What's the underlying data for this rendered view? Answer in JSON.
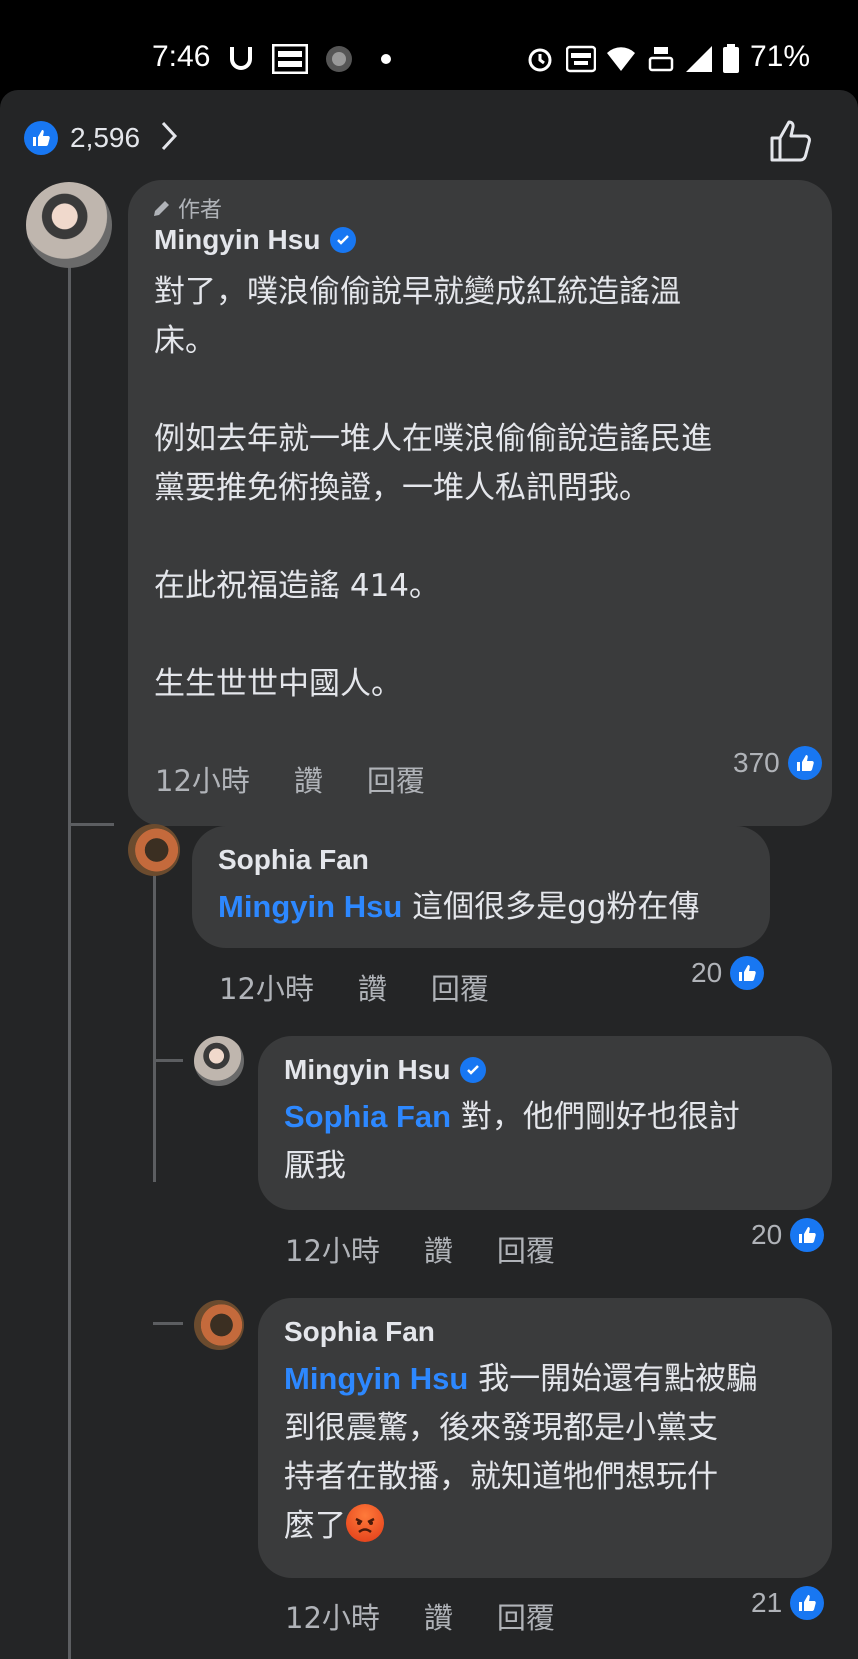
{
  "status_bar": {
    "time": "7:46",
    "battery": "71%",
    "icons": [
      "u-icon",
      "momo-app-icon",
      "app-icon",
      "dot-icon",
      "alarm-icon",
      "auto-hz-icon",
      "wifi-icon",
      "volte-icon",
      "signal-icon",
      "battery-icon"
    ]
  },
  "header": {
    "like_count": "2,596"
  },
  "comments": [
    {
      "author_tag": "作者",
      "name": "Mingyin Hsu",
      "verified": true,
      "text": "對了，噗浪偷偷說早就變成紅統造謠溫\n床。\n\n例如去年就一堆人在噗浪偷偷說造謠民進\n黨要推免術換證，一堆人私訊問我。\n\n在此祝福造謠 414。\n\n生生世世中國人。",
      "time": "12小時",
      "like_label": "讚",
      "reply_label": "回覆",
      "reactions": "370"
    },
    {
      "name": "Sophia Fan",
      "mention": "Mingyin Hsu",
      "text": " 這個很多是gg粉在傳",
      "time": "12小時",
      "like_label": "讚",
      "reply_label": "回覆",
      "reactions": "20"
    },
    {
      "name": "Mingyin Hsu",
      "verified": true,
      "mention": "Sophia Fan",
      "text": " 對，他們剛好也很討\n厭我",
      "time": "12小時",
      "like_label": "讚",
      "reply_label": "回覆",
      "reactions": "20"
    },
    {
      "name": "Sophia Fan",
      "mention": "Mingyin Hsu",
      "text": " 我一開始還有點被騙\n到很震驚，後來發現都是小黨支\n持者在散播，就知道牠們想玩什\n麼了",
      "time": "12小時",
      "like_label": "讚",
      "reply_label": "回覆",
      "reactions": "21"
    }
  ]
}
